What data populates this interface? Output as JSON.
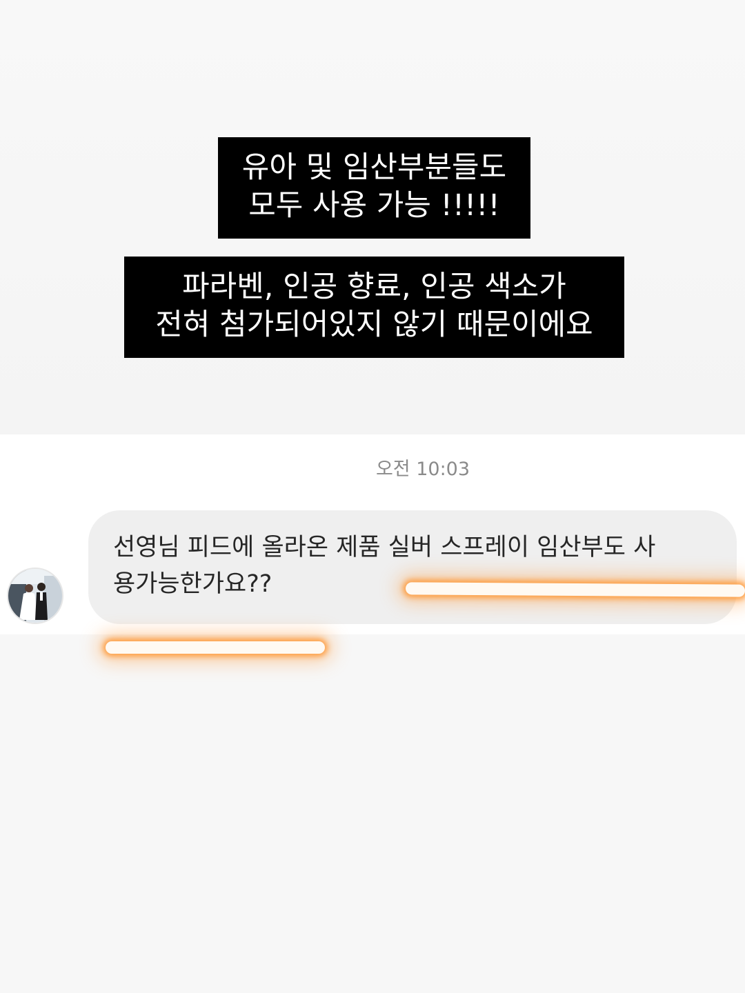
{
  "captions": {
    "first": {
      "line1": "유아 및 임산부분들도",
      "line2": "모두 사용 가능 !!!!!"
    },
    "second": {
      "line1": "파라벤, 인공 향료, 인공 색소가",
      "line2": "전혀 첨가되어있지 않기 때문이에요"
    }
  },
  "chat": {
    "timestamp": "오전 10:03",
    "message": {
      "line1": "선영님 피드에 올라온 제품 실버 스프레이 임산부도 사",
      "line2": "용가능한가요??"
    }
  },
  "colors": {
    "caption_bg": "#000000",
    "caption_text": "#ffffff",
    "bubble_bg": "#efefef",
    "highlight_glow": "#ff9632"
  },
  "icons": {
    "avatar": "profile-photo-wedding-couple"
  }
}
